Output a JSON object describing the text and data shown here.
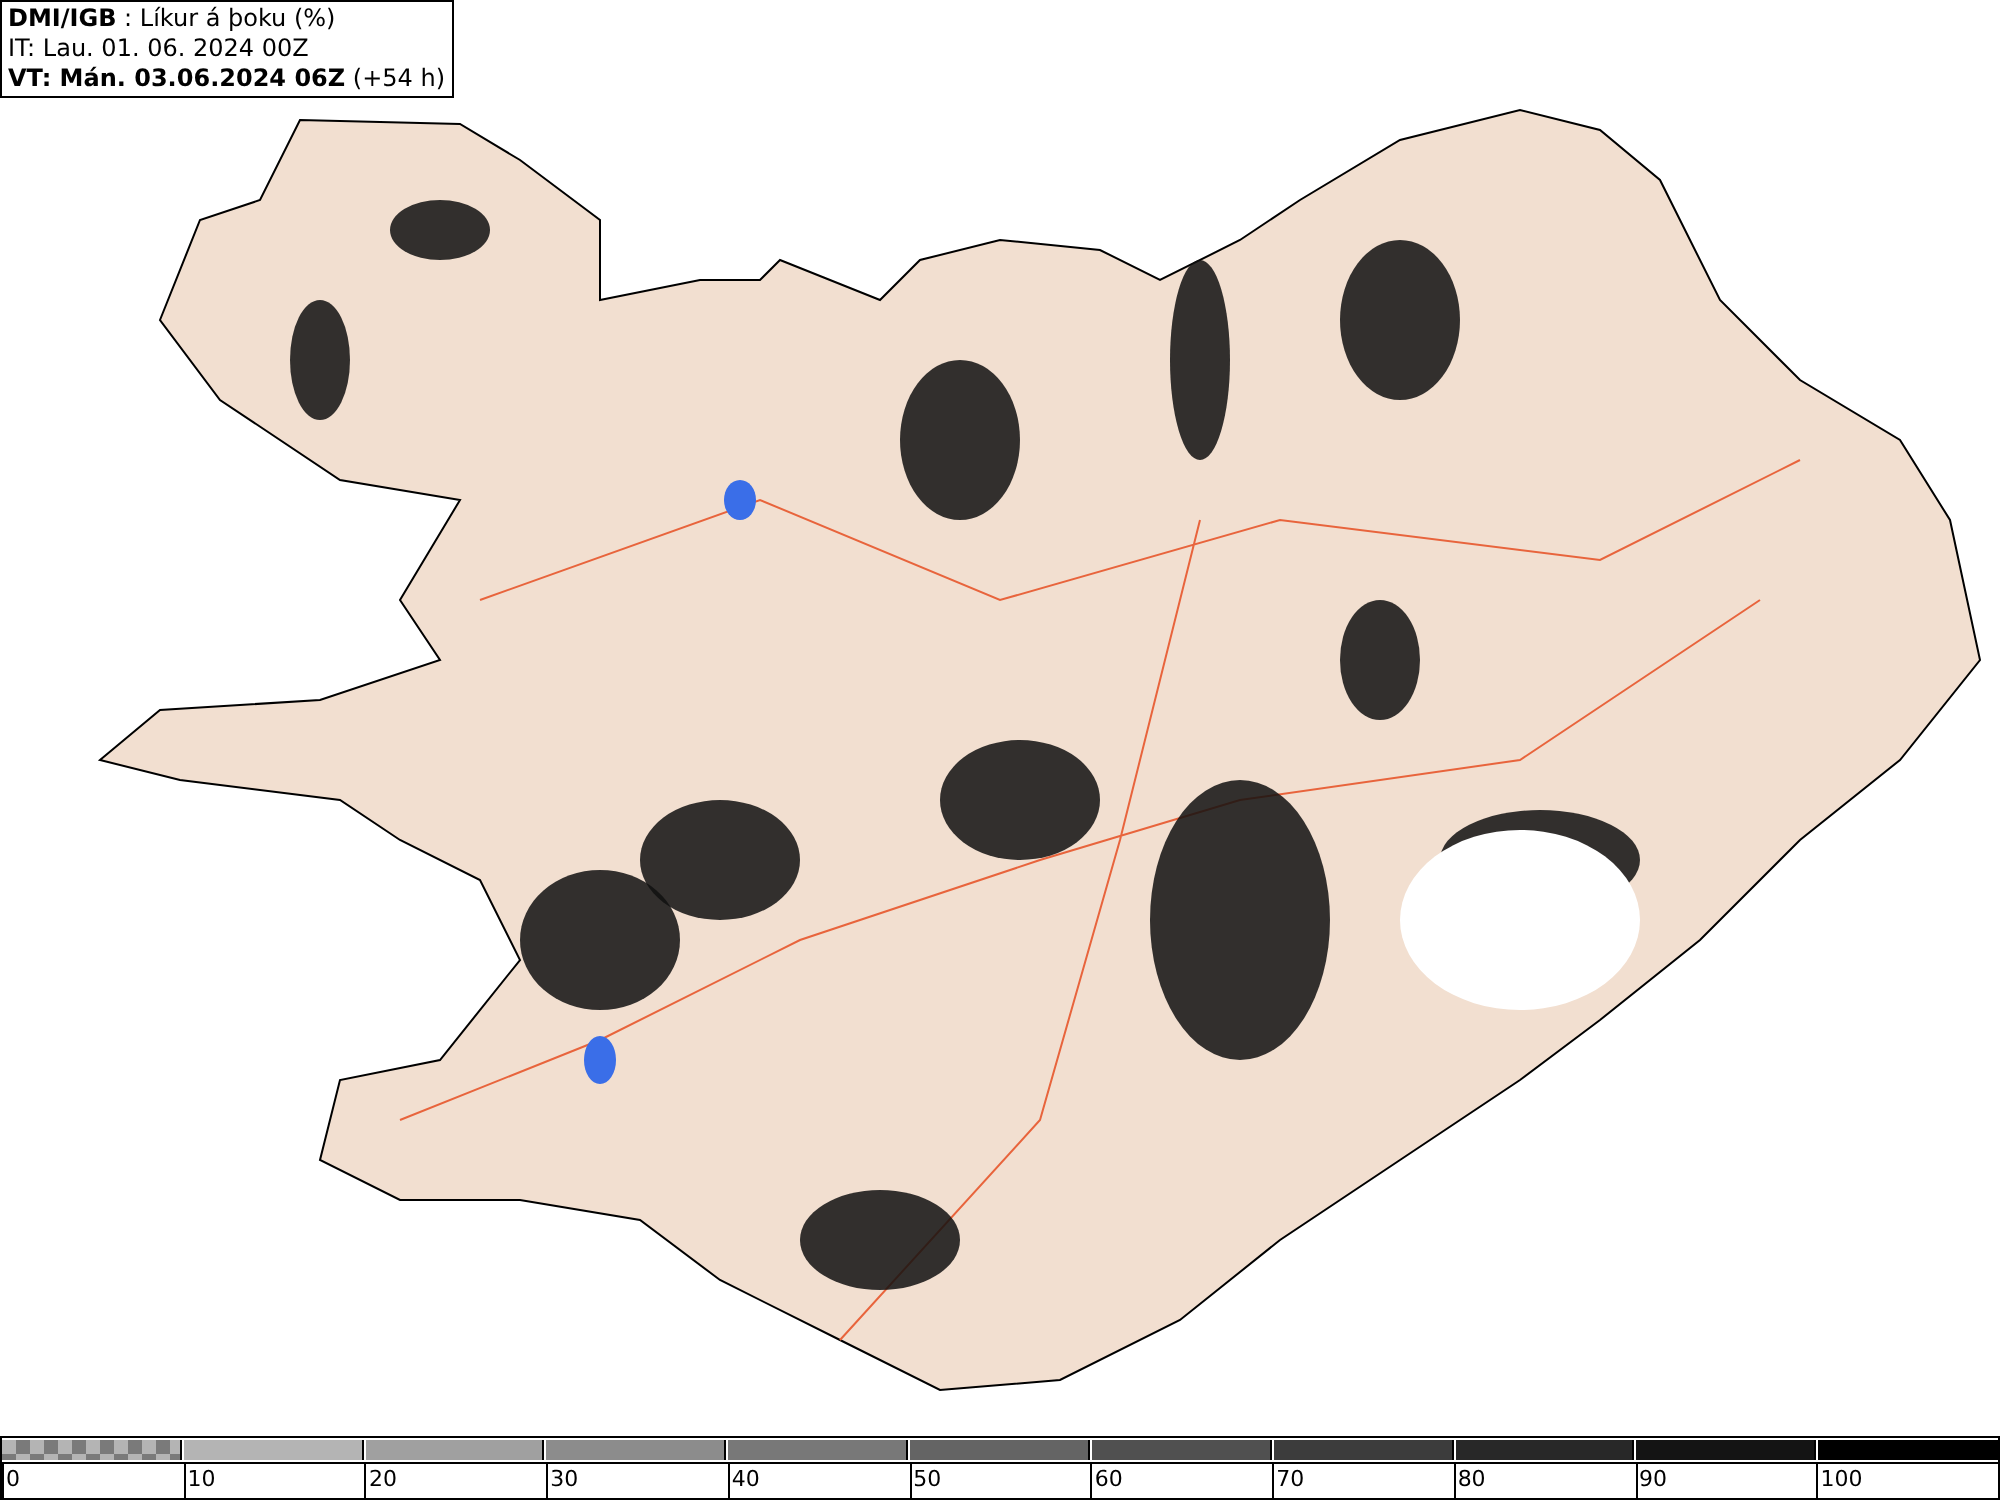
{
  "header": {
    "lines": [
      "**DMI/IGB** : Líkur á þoku (%)",
      "IT: Lau. 01. 06. 2024 00Z",
      "**VT: Mán. 03.06.2024 06Z** (+54 h)"
    ]
  },
  "legend": {
    "segments": [
      {
        "kind": "checkered",
        "color": "#7a7a7a"
      },
      {
        "kind": "solid",
        "color": "#b4b4b4"
      },
      {
        "kind": "solid",
        "color": "#a0a0a0"
      },
      {
        "kind": "solid",
        "color": "#8c8c8c"
      },
      {
        "kind": "solid",
        "color": "#787878"
      },
      {
        "kind": "solid",
        "color": "#646464"
      },
      {
        "kind": "solid",
        "color": "#505050"
      },
      {
        "kind": "solid",
        "color": "#3c3c3c"
      },
      {
        "kind": "solid",
        "color": "#282828"
      },
      {
        "kind": "solid",
        "color": "#141414"
      },
      {
        "kind": "solid",
        "color": "#000000"
      }
    ],
    "ticks": [
      "0",
      "10",
      "20",
      "30",
      "40",
      "50",
      "60",
      "70",
      "80",
      "90",
      "100"
    ]
  }
}
